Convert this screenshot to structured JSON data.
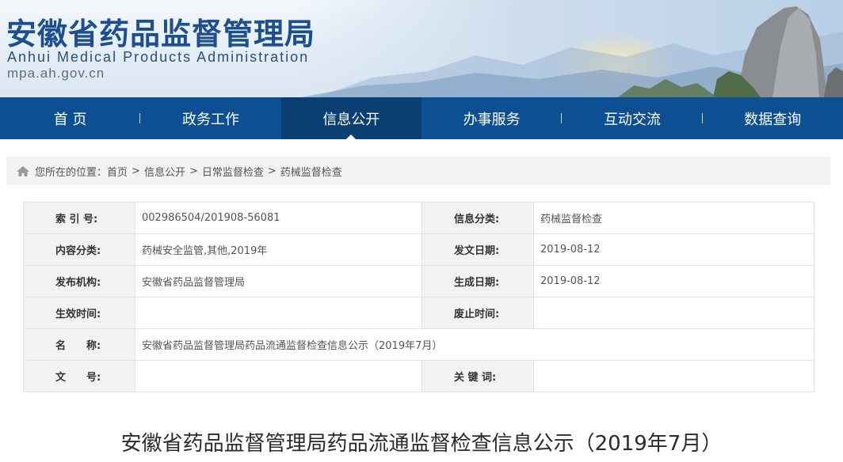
{
  "header": {
    "title_cn": "安徽省药品监督管理局",
    "title_en": "Anhui Medical Products Administration",
    "url": "mpa.ah.gov.cn"
  },
  "nav": {
    "items": [
      {
        "label": "首 页"
      },
      {
        "label": "政务工作"
      },
      {
        "label": "信息公开"
      },
      {
        "label": "办事服务"
      },
      {
        "label": "互动交流"
      },
      {
        "label": "数据查询"
      }
    ],
    "active_index": 2
  },
  "breadcrumb": {
    "prefix": "您所在的位置：",
    "items": [
      "首页",
      "信息公开",
      "日常监督检查",
      "药械监督检查"
    ],
    "separator": ">"
  },
  "info": {
    "index_label": "索 引 号:",
    "index_value": "002986504/201908-56081",
    "category_label": "信息分类:",
    "category_value": "药械监督检查",
    "content_label": "内容分类:",
    "content_value": "药械安全监管,其他,2019年",
    "issue_label": "发文日期:",
    "issue_value": "2019-08-12",
    "publisher_label": "发布机构:",
    "publisher_value": "安徽省药品监督管理局",
    "created_label": "生成日期:",
    "created_value": "2019-08-12",
    "effective_label": "生效时间:",
    "effective_value": "",
    "expire_label": "废止时间:",
    "expire_value": "",
    "name_label": "名　　称:",
    "name_value": "安徽省药品监督管理局药品流通监督检查信息公示（2019年7月）",
    "docno_label": "文　　号:",
    "docno_value": "",
    "keywords_label": "关 键 词:",
    "keywords_value": ""
  },
  "article": {
    "title": "安徽省药品监督管理局药品流通监督检查信息公示（2019年7月）"
  },
  "colors": {
    "nav_bg": "#0c5093",
    "nav_active": "#0a3f74",
    "title_blue": "#1d4f8f"
  }
}
